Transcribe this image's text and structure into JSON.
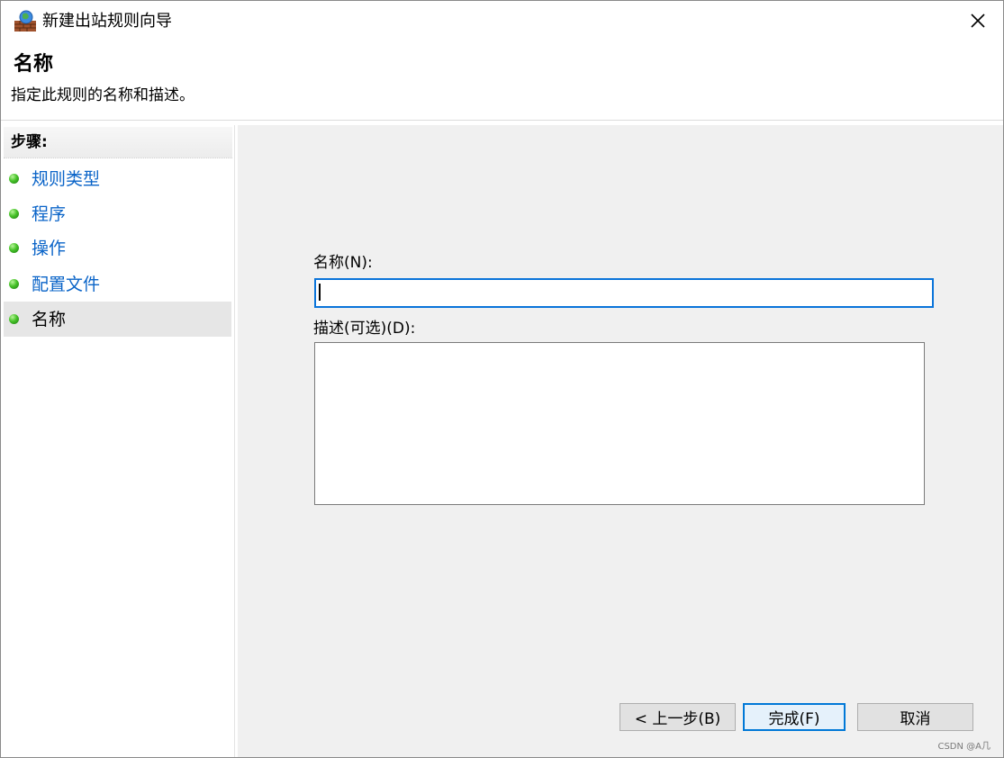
{
  "window": {
    "title": "新建出站规则向导",
    "close_icon": "close-icon",
    "app_icon": "firewall-icon"
  },
  "header": {
    "title": "名称",
    "description": "指定此规则的名称和描述。"
  },
  "sidebar": {
    "heading": "步骤:",
    "items": [
      {
        "label": "规则类型",
        "active": false
      },
      {
        "label": "程序",
        "active": false
      },
      {
        "label": "操作",
        "active": false
      },
      {
        "label": "配置文件",
        "active": false
      },
      {
        "label": "名称",
        "active": true
      }
    ]
  },
  "form": {
    "name_label": "名称(N):",
    "name_value": "",
    "description_label": "描述(可选)(D):",
    "description_value": ""
  },
  "buttons": {
    "back": "< 上一步(B)",
    "finish": "完成(F)",
    "cancel": "取消"
  },
  "watermark": "CSDN @A几",
  "colors": {
    "link": "#0a64c8",
    "focus_border": "#0078d7",
    "content_bg": "#f0f0f0",
    "step_dot": "#46c228"
  }
}
